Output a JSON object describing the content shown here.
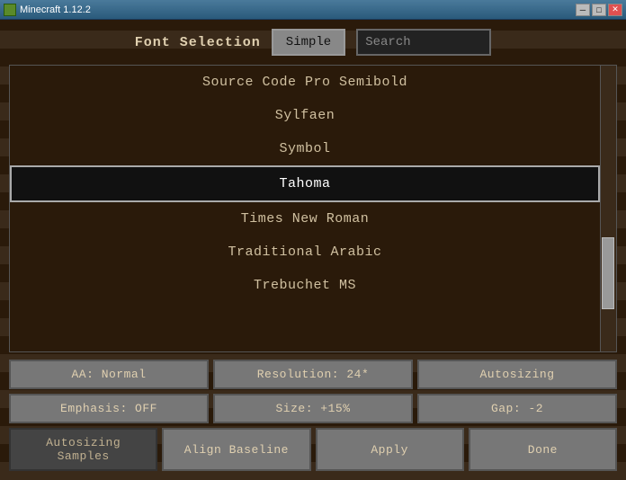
{
  "titlebar": {
    "title": "Minecraft 1.12.2",
    "min_btn": "─",
    "max_btn": "□",
    "close_btn": "✕"
  },
  "header": {
    "font_selection_label": "Font Selection",
    "simple_btn_label": "Simple",
    "search_placeholder": "Search"
  },
  "font_list": {
    "items": [
      {
        "name": "Source Code Pro Semibold",
        "selected": false
      },
      {
        "name": "Sylfaen",
        "selected": false
      },
      {
        "name": "Symbol",
        "selected": false
      },
      {
        "name": "Tahoma",
        "selected": true
      },
      {
        "name": "Times New Roman",
        "selected": false
      },
      {
        "name": "Traditional Arabic",
        "selected": false
      },
      {
        "name": "Trebuchet MS",
        "selected": false
      }
    ]
  },
  "controls": {
    "row1": {
      "aa": "AA: Normal",
      "resolution": "Resolution: 24*",
      "autosizing": "Autosizing"
    },
    "row2": {
      "emphasis": "Emphasis: OFF",
      "size": "Size: +15%",
      "gap": "Gap: -2"
    },
    "row3": {
      "autosizing_samples": "Autosizing Samples",
      "align_baseline": "Align Baseline",
      "apply": "Apply",
      "done": "Done"
    }
  }
}
